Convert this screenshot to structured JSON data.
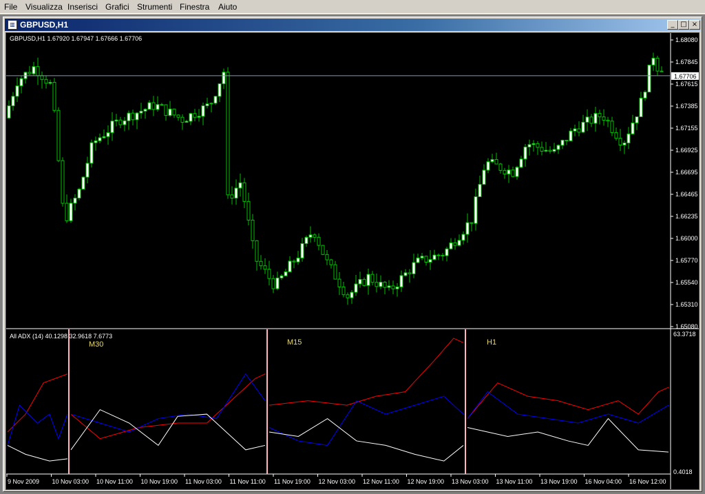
{
  "menu": [
    "File",
    "Visualizza",
    "Inserisci",
    "Grafici",
    "Strumenti",
    "Finestra",
    "Aiuto"
  ],
  "window": {
    "title": "GBPUSD,H1",
    "min_glyph": "_",
    "max_glyph": "□",
    "close_glyph": "×"
  },
  "main_chart": {
    "header": "GBPUSD,H1  1.67920 1.67947 1.67666 1.67706",
    "current_price_label": "1.67706",
    "current_price": 1.67706,
    "price_ticks": [
      "1.68080",
      "1.67845",
      "1.67615",
      "1.67385",
      "1.67155",
      "1.66925",
      "1.66695",
      "1.66465",
      "1.66235",
      "1.66000",
      "1.65770",
      "1.65540",
      "1.65310",
      "1.65080"
    ],
    "price_min": 1.6508,
    "price_max": 1.6808,
    "candle_color": "#00c000",
    "bull_body_color": "#ffffff",
    "bear_body_color": "#000000"
  },
  "indicator": {
    "header": "All ADX (14) 40.1298 32.9618 7.6773",
    "scale_top": "63.3718",
    "scale_bottom": "0.4018",
    "ymin": 0.4018,
    "ymax": 63.3718,
    "panels": [
      {
        "label": "M30"
      },
      {
        "label": "M15"
      },
      {
        "label": "H1"
      }
    ],
    "separator_color": "#ffb6c1"
  },
  "time_axis": [
    "9 Nov 2009",
    "10 Nov 03:00",
    "10 Nov 11:00",
    "10 Nov 19:00",
    "11 Nov 03:00",
    "11 Nov 11:00",
    "11 Nov 19:00",
    "12 Nov 03:00",
    "12 Nov 11:00",
    "12 Nov 19:00",
    "13 Nov 03:00",
    "13 Nov 11:00",
    "13 Nov 19:00",
    "16 Nov 04:00",
    "16 Nov 12:00"
  ],
  "colors": {
    "adx_line": "#ffffff",
    "plus_di": "#ff0000",
    "minus_di": "#0000ff",
    "grid": "#ffffff"
  }
}
